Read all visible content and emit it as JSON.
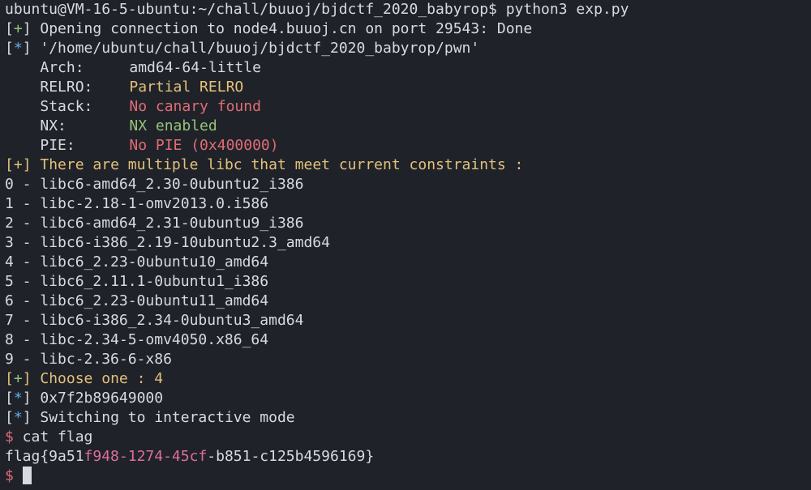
{
  "colors": {
    "background": "#1f2329",
    "foreground": "#d7dbe0",
    "green": "#98c379",
    "blue": "#61afef",
    "yellow": "#e5c07b",
    "red": "#e06c75",
    "magenta": "#e06c9f"
  },
  "lines": {
    "prompt_cmd": "ubuntu@VM-16-5-ubuntu:~/chall/buuoj/bjdctf_2020_babyrop$ python3 exp.py",
    "open_conn": {
      "bracket_open": "[",
      "mark": "+",
      "bracket_close": "]",
      "text": " Opening connection to node4.buuoj.cn on port 29543: Done"
    },
    "path_line": {
      "bracket_open": "[",
      "mark": "*",
      "bracket_close": "]",
      "text": " '/home/ubuntu/chall/buuoj/bjdctf_2020_babyrop/pwn'"
    },
    "checksec": [
      {
        "label": "Arch:",
        "value": "amd64-64-little",
        "color": "white"
      },
      {
        "label": "RELRO:",
        "value": "Partial RELRO",
        "color": "yellow"
      },
      {
        "label": "Stack:",
        "value": "No canary found",
        "color": "red"
      },
      {
        "label": "NX:",
        "value": "NX enabled",
        "color": "green"
      },
      {
        "label": "PIE:",
        "value": "No PIE (0x400000)",
        "color": "red"
      }
    ],
    "multi_libc": {
      "mark": "+",
      "text": " There are multiple libc that meet current constraints :"
    },
    "libc_options": [
      "0 - libc6-amd64_2.30-0ubuntu2_i386",
      "1 - libc-2.18-1-omv2013.0.i586",
      "2 - libc6-amd64_2.31-0ubuntu9_i386",
      "3 - libc6-i386_2.19-10ubuntu2.3_amd64",
      "4 - libc6_2.23-0ubuntu10_amd64",
      "5 - libc6_2.11.1-0ubuntu1_i386",
      "6 - libc6_2.23-0ubuntu11_amd64",
      "7 - libc6-i386_2.34-0ubuntu3_amd64",
      "8 - libc-2.34-5-omv4050.x86_64",
      "9 - libc-2.36-6-x86"
    ],
    "choose": {
      "mark": "+",
      "text": " Choose one : 4"
    },
    "addr": {
      "mark": "*",
      "text": " 0x7f2b89649000"
    },
    "interactive": {
      "mark": "*",
      "text": " Switching to interactive mode"
    },
    "cat_cmd": {
      "dollar": "$",
      "text": " cat flag"
    },
    "flag": {
      "part1": "flag{9a51",
      "part2": "f948-1274-45cf",
      "part3": "-b851-c125b4596169}"
    },
    "final_prompt": {
      "dollar": "$"
    }
  }
}
